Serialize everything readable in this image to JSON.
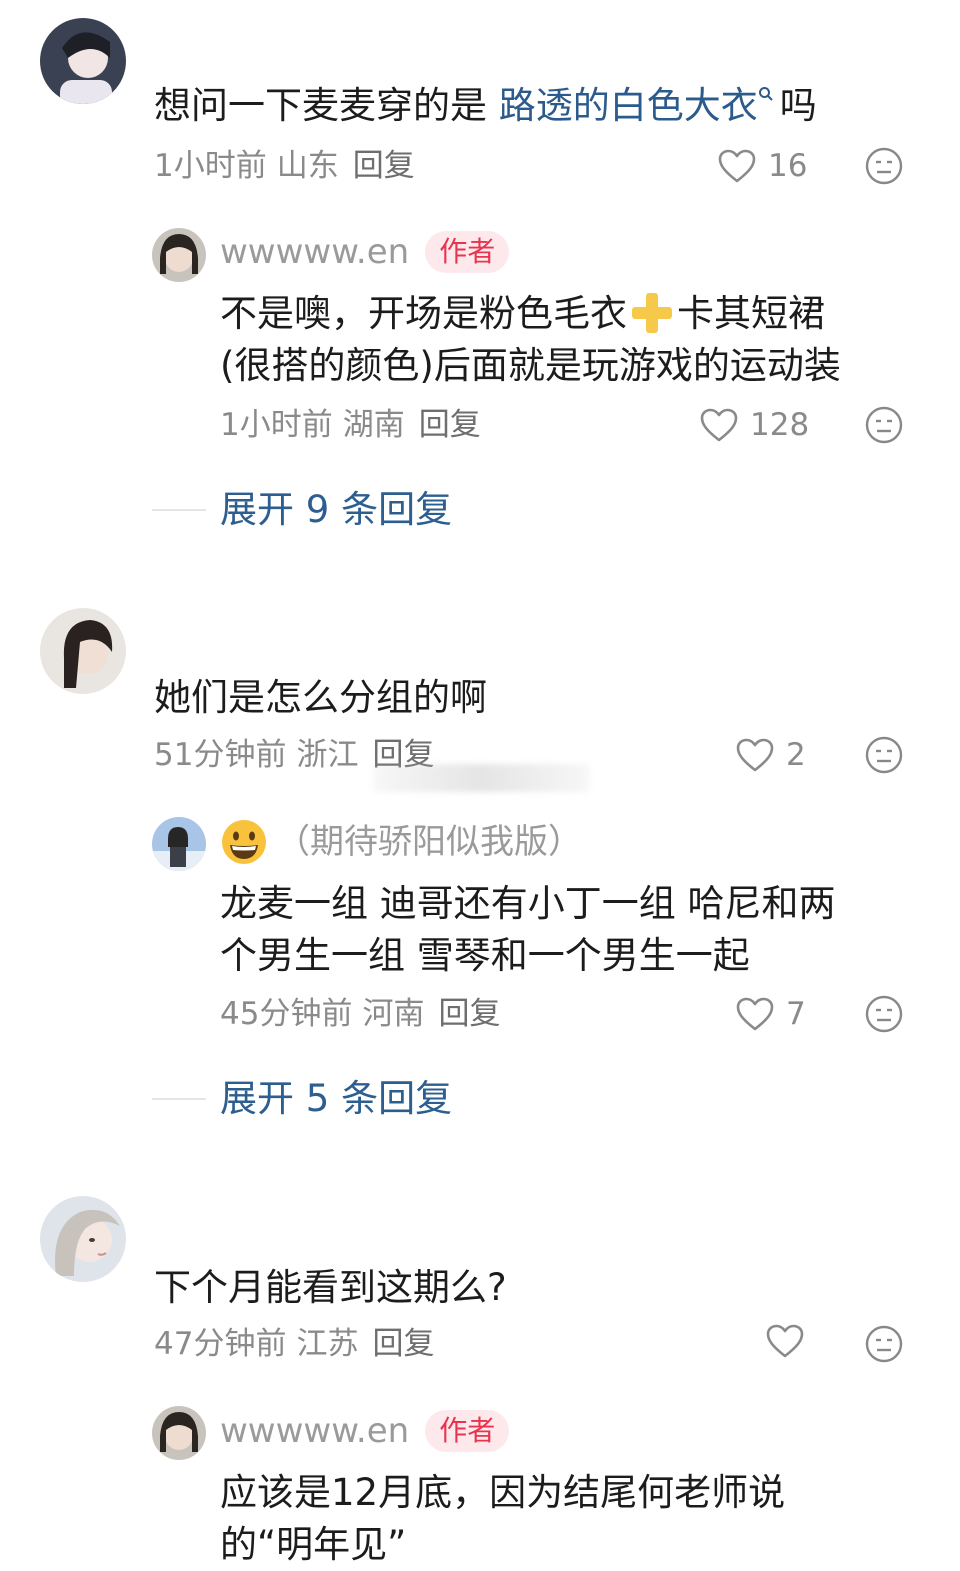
{
  "comments": [
    {
      "text_prefix": "想问一下麦麦穿的是 ",
      "link_text": "路透的白色大衣",
      "text_suffix": "吗",
      "time": "1小时前",
      "location": "山东",
      "reply_label": "回复",
      "likes": "16",
      "reply": {
        "username": "wwwww.en",
        "badge": "作者",
        "line1_a": "不是噢，开场是粉色毛衣",
        "line1_b": "卡其短裙",
        "line2": "(很搭的颜色)后面就是玩游戏的运动装",
        "time": "1小时前",
        "location": "湖南",
        "reply_label": "回复",
        "likes": "128"
      },
      "expand_label": "展开 9 条回复"
    },
    {
      "text": "她们是怎么分组的啊",
      "time": "51分钟前",
      "location": "浙江",
      "reply_label": "回复",
      "likes": "2",
      "reply": {
        "username": "（期待骄阳似我版）",
        "line1": "龙麦一组 迪哥还有小丁一组 哈尼和两",
        "line2": "个男生一组 雪琴和一个男生一起",
        "time": "45分钟前",
        "location": "河南",
        "reply_label": "回复",
        "likes": "7"
      },
      "expand_label": "展开 5 条回复"
    },
    {
      "text": "下个月能看到这期么?",
      "time": "47分钟前",
      "location": "江苏",
      "reply_label": "回复",
      "reply": {
        "username": "wwwww.en",
        "badge": "作者",
        "line1": "应该是12月底，因为结尾何老师说",
        "line2": "的“明年见”"
      }
    }
  ],
  "icons": {
    "like": "heart-outline-icon",
    "more": "neutral-face-icon",
    "search": "search-icon",
    "plus": "plus-emoji-icon",
    "grin": "grinning-face-emoji-icon"
  },
  "colors": {
    "link": "#2b5a8c",
    "expand": "#2d5e90",
    "badge_bg": "#fde9ec",
    "badge_text": "#e8344e",
    "meta": "#8a8a8a"
  }
}
